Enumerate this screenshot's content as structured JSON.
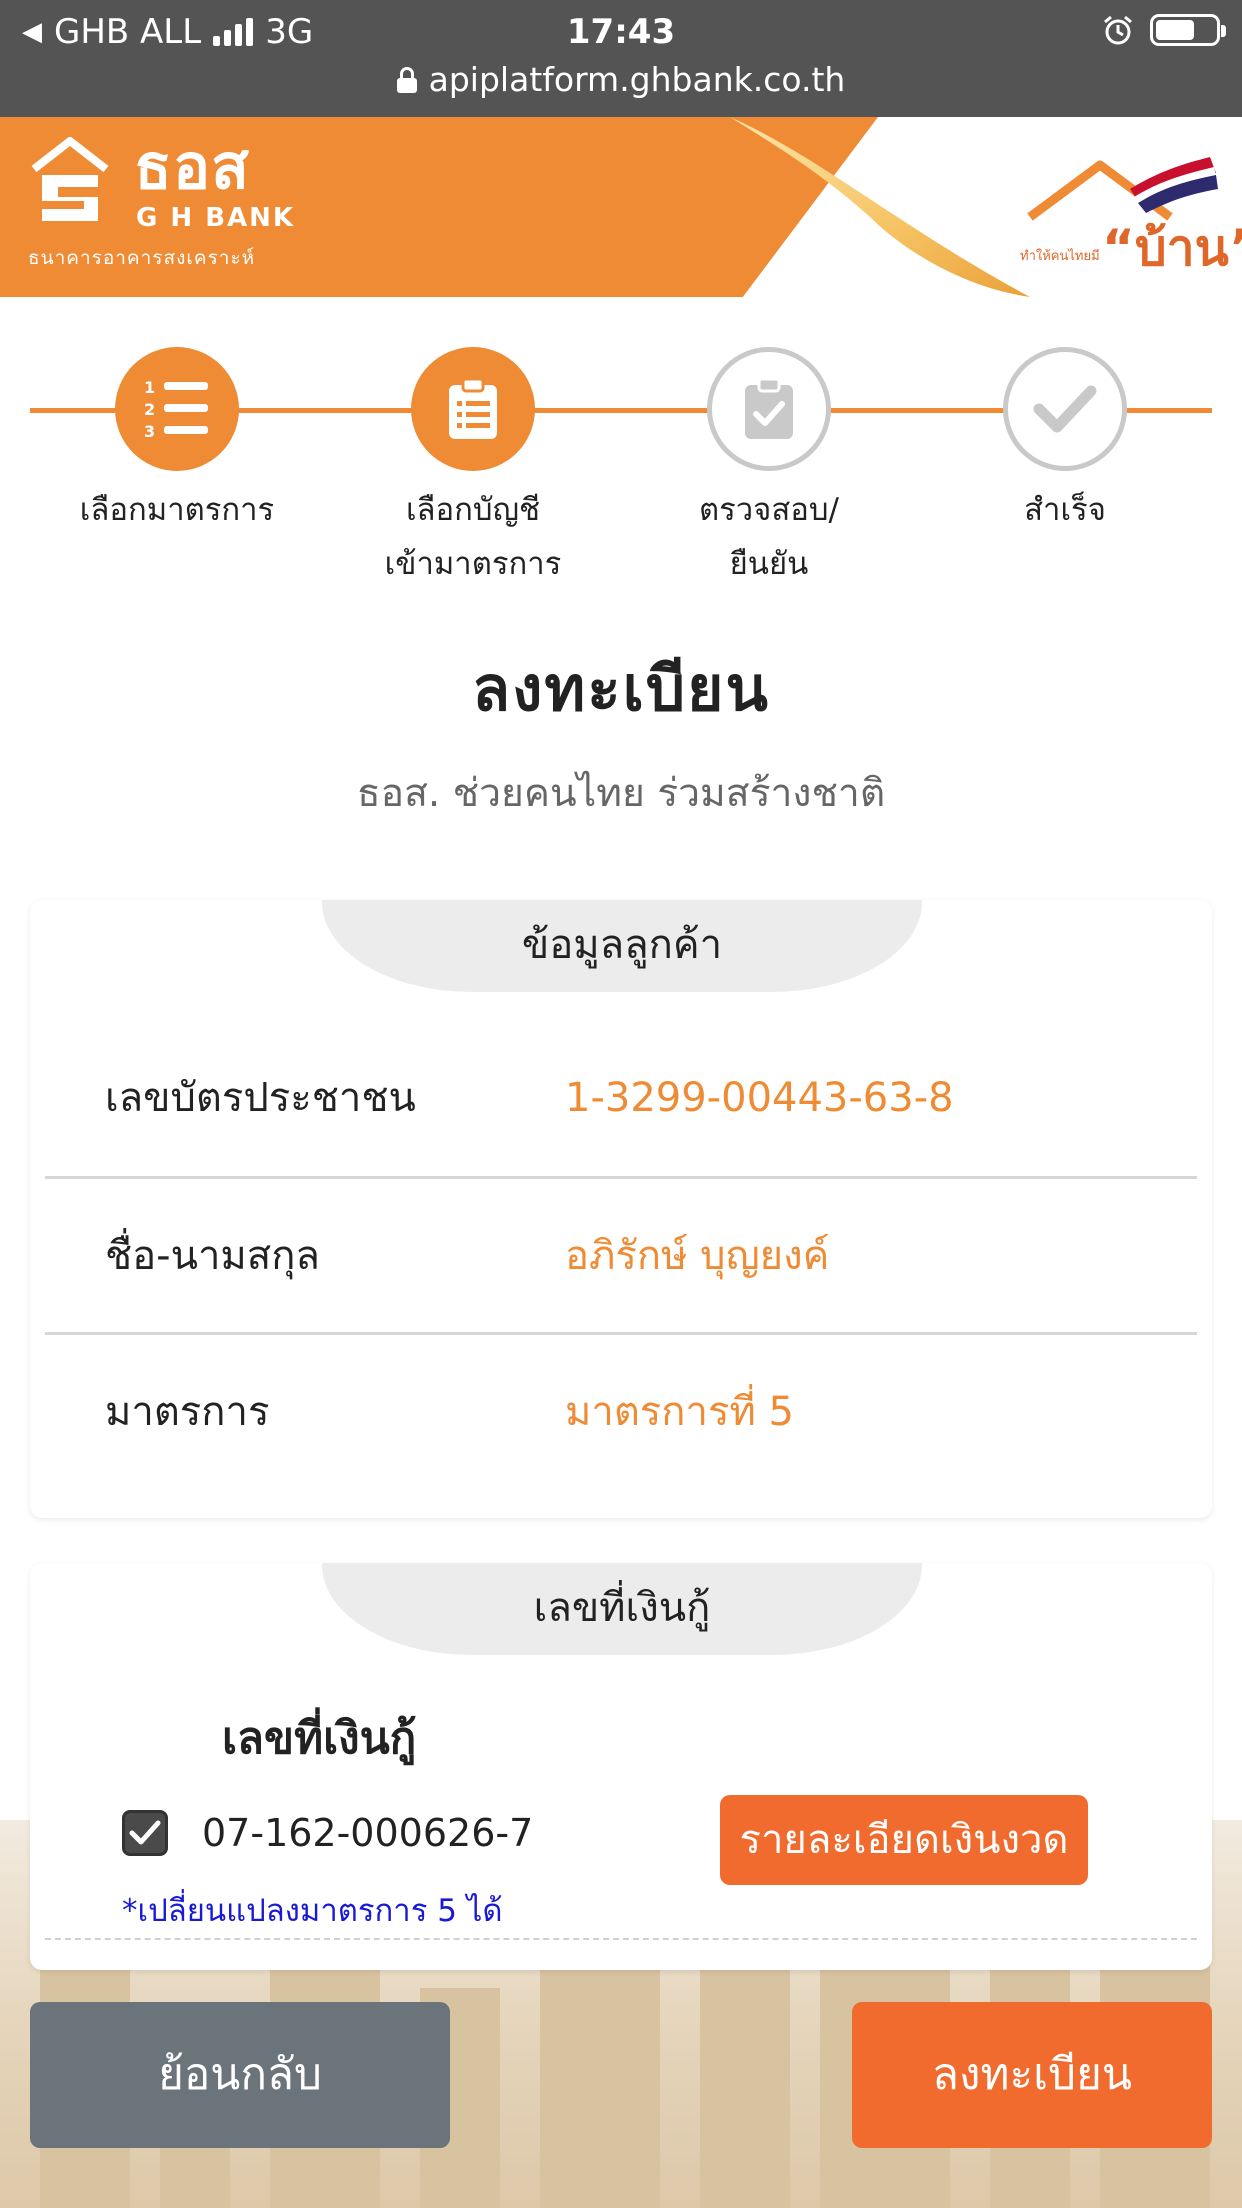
{
  "status_bar": {
    "carrier": "GHB ALL",
    "network": "3G",
    "time": "17:43",
    "url": "apiplatform.ghbank.co.th"
  },
  "banner": {
    "logo_thai": "ธอส",
    "logo_english": "G H BANK",
    "logo_subtitle": "ธนาคารอาคารสงเคราะห์",
    "campaign_small": "ทำให้คนไทยมี",
    "campaign_big": "“บ้าน”",
    "colors": {
      "brand_orange": "#ef8b34"
    }
  },
  "stepper": {
    "steps": [
      {
        "line1": "เลือกมาตรการ",
        "line2": "",
        "state": "active",
        "icon": "numbered-list-icon"
      },
      {
        "line1": "เลือกบัญชี",
        "line2": "เข้ามาตรการ",
        "state": "active",
        "icon": "clipboard-list-icon"
      },
      {
        "line1": "ตรวจสอบ/",
        "line2": "ยืนยัน",
        "state": "inactive",
        "icon": "clipboard-check-icon"
      },
      {
        "line1": "สำเร็จ",
        "line2": "",
        "state": "inactive",
        "icon": "check-icon"
      }
    ]
  },
  "page": {
    "title": "ลงทะเบียน",
    "subtitle": "ธอส. ช่วยคนไทย ร่วมสร้างชาติ"
  },
  "customer_card": {
    "tab_title": "ข้อมูลลูกค้า",
    "rows": [
      {
        "label": "เลขบัตรประชาชน",
        "value": "1-3299-00443-63-8"
      },
      {
        "label": "ชื่อ-นามสกุล",
        "value": "อภิรักษ์ บุญยงค์"
      },
      {
        "label": "มาตรการ",
        "value": "มาตรการที่ 5"
      }
    ]
  },
  "loan_card": {
    "tab_title": "เลขที่เงินกู้",
    "heading": "เลขที่เงินกู้",
    "loan_number": "07-162-000626-7",
    "checked": true,
    "detail_button": "รายละเอียดเงินงวด",
    "note": "*เปลี่ยนแปลงมาตรการ 5 ได้"
  },
  "actions": {
    "back": "ย้อนกลับ",
    "register": "ลงทะเบียน"
  }
}
